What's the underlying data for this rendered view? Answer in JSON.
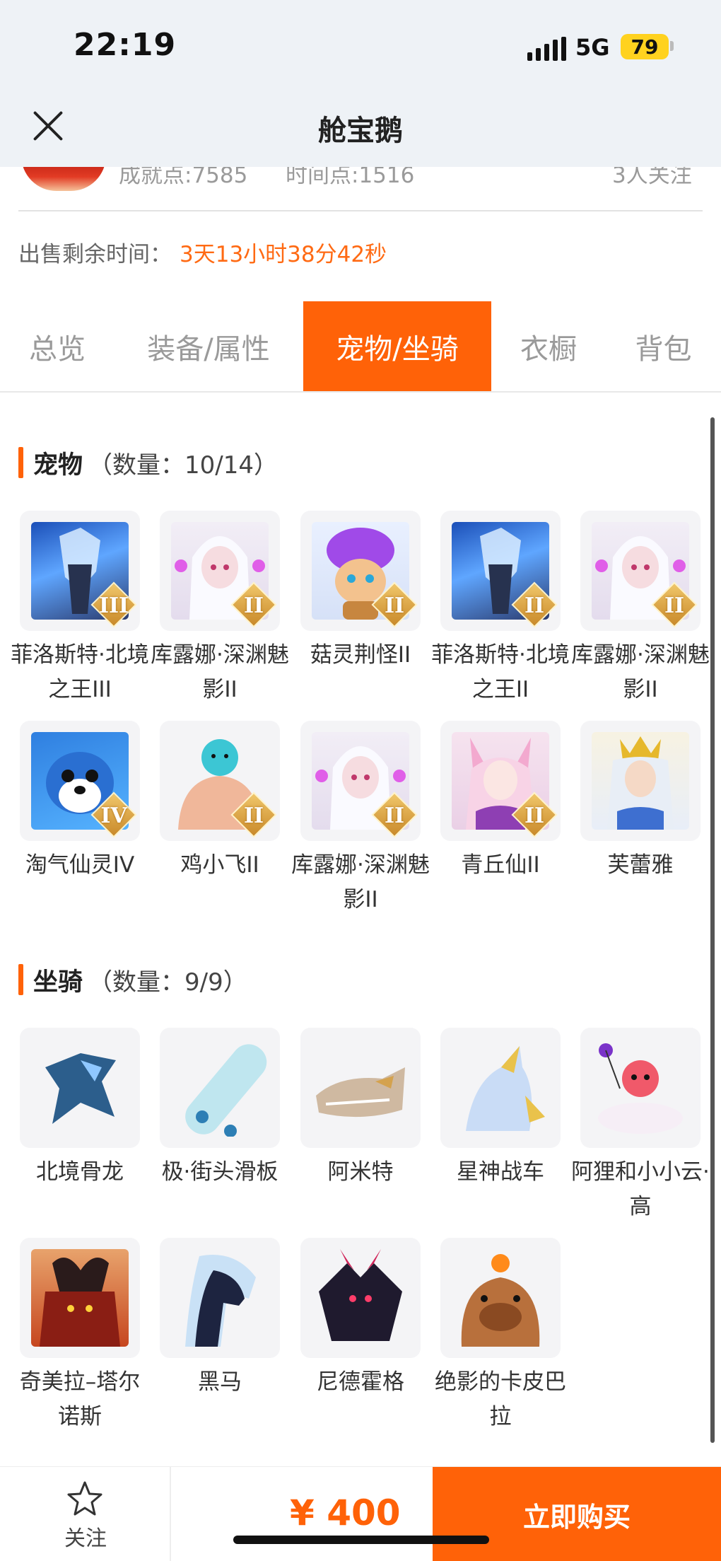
{
  "status_bar": {
    "time": "22:19",
    "network": "5G",
    "battery": "79"
  },
  "header": {
    "title": "舱宝鹅"
  },
  "info": {
    "achievement": "成就点:7585",
    "time_points": "时间点:1516",
    "followers": "3人关注"
  },
  "sale": {
    "label": "出售剩余时间：",
    "remaining": "3天13小时38分42秒"
  },
  "tabs": [
    "总览",
    "装备/属性",
    "宠物/坐骑",
    "衣橱",
    "背包"
  ],
  "active_tab": "宠物/坐骑",
  "pets": {
    "title": "宠物",
    "count": "（数量：10/14）",
    "items": [
      {
        "name": "菲洛斯特·北境之王III",
        "grade": "III",
        "icon": "ice-dragon-king-icon"
      },
      {
        "name": "库露娜·深渊魅影II",
        "grade": "II",
        "icon": "white-hair-fairy-icon"
      },
      {
        "name": "菇灵荆怪II",
        "grade": "II",
        "icon": "purple-mushroom-sprite-icon"
      },
      {
        "name": "菲洛斯特·北境之王II",
        "grade": "II",
        "icon": "ice-dragon-king-icon"
      },
      {
        "name": "库露娜·深渊魅影II",
        "grade": "II",
        "icon": "white-hair-fairy-icon"
      },
      {
        "name": "淘气仙灵IV",
        "grade": "IV",
        "icon": "blue-puppy-icon"
      },
      {
        "name": "鸡小飞II",
        "grade": "II",
        "icon": "blue-chick-icon"
      },
      {
        "name": "库露娜·深渊魅影II",
        "grade": "II",
        "icon": "white-hair-fairy-icon"
      },
      {
        "name": "青丘仙II",
        "grade": "II",
        "icon": "fox-spirit-icon"
      },
      {
        "name": "芙蕾雅",
        "grade": "",
        "icon": "golden-crown-goddess-icon"
      }
    ]
  },
  "mounts": {
    "title": "坐骑",
    "count": "（数量：9/9）",
    "items": [
      {
        "name": "北境骨龙",
        "icon": "bone-dragon-icon"
      },
      {
        "name": "极·街头滑板",
        "icon": "skateboard-icon"
      },
      {
        "name": "阿米特",
        "icon": "crocodile-icon"
      },
      {
        "name": "星神战车",
        "icon": "star-horse-icon"
      },
      {
        "name": "阿狸和小小云·高",
        "icon": "ali-cloud-icon"
      },
      {
        "name": "奇美拉–塔尔诺斯",
        "icon": "chimera-icon"
      },
      {
        "name": "黑马",
        "icon": "black-horse-icon"
      },
      {
        "name": "尼德霍格",
        "icon": "dark-dragon-icon"
      },
      {
        "name": "绝影的卡皮巴拉",
        "icon": "capybara-icon"
      }
    ]
  },
  "bottom_bar": {
    "follow_label": "关注",
    "price": "¥ 400",
    "buy_label": "立即购买"
  },
  "colors": {
    "accent": "#ff6208",
    "countdown": "#ff6a13"
  }
}
